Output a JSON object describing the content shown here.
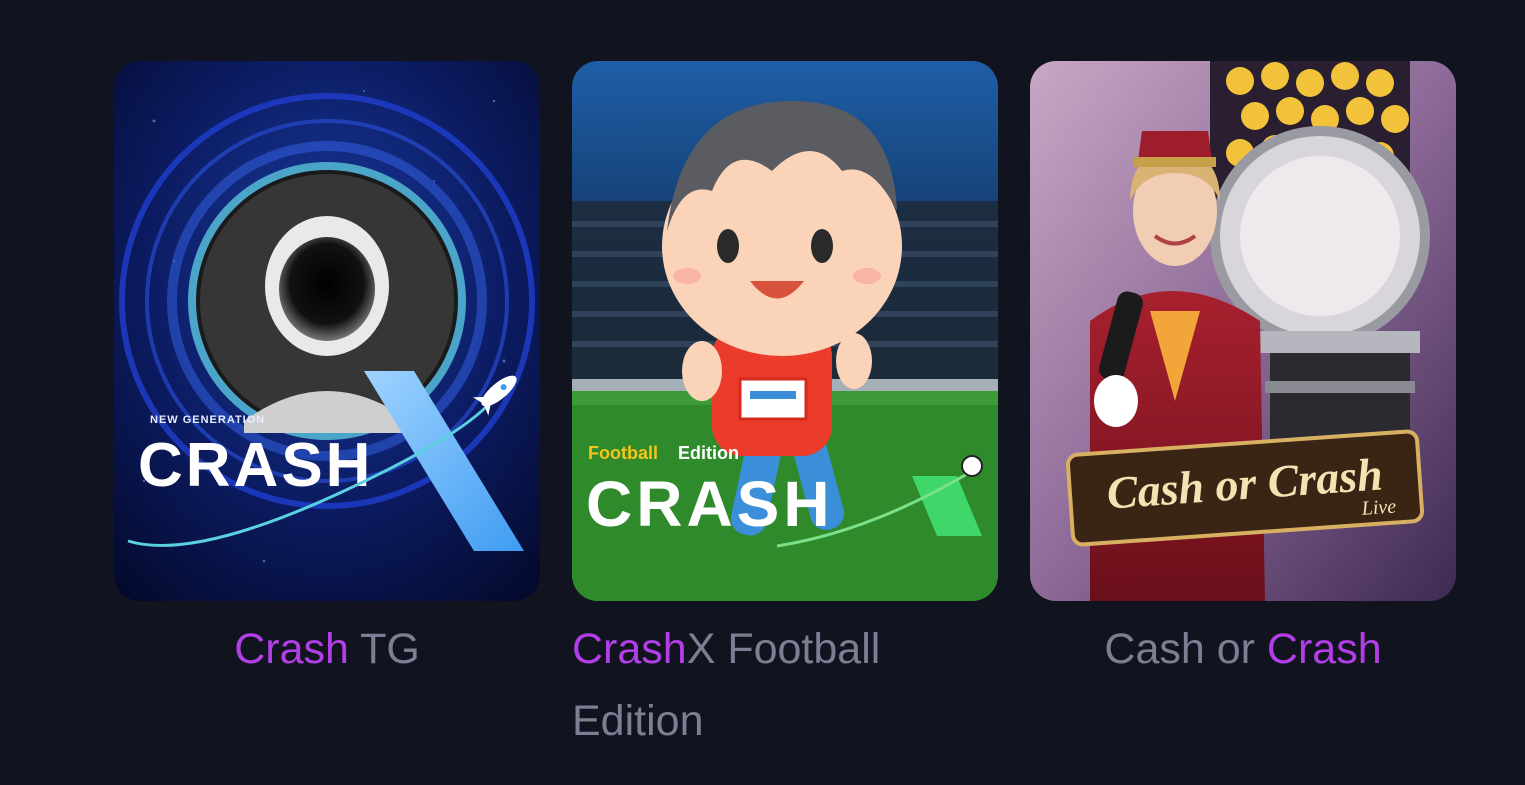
{
  "games": [
    {
      "art": {
        "badge": "NEW GENERATION",
        "logo": "CRASH"
      },
      "title": {
        "highlight": "Crash",
        "rest": " TG"
      }
    },
    {
      "art": {
        "badge_a": "Football",
        "badge_b": "Edition",
        "logo": "CRASH"
      },
      "title": {
        "highlight": "Crash",
        "rest": "X Football Edition"
      }
    },
    {
      "art": {
        "logo": "Cash or Crash",
        "sub": "Live"
      },
      "title": {
        "prefix": "Cash or ",
        "highlight": "Crash"
      }
    }
  ],
  "colors": {
    "background": "#11131e",
    "highlight": "#b23ee8",
    "muted_text": "#7a7f94"
  }
}
